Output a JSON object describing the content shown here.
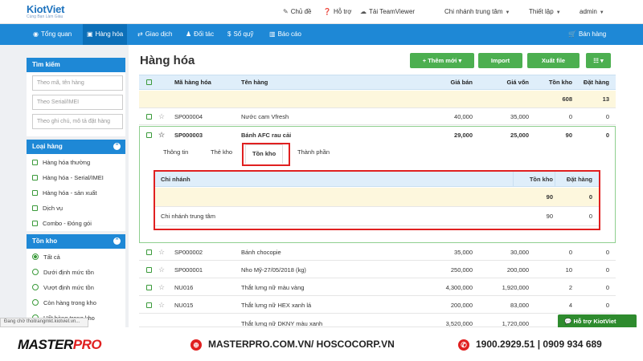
{
  "app": {
    "logo": "KiotViet",
    "tagline": "Cùng Bạn Làm Giàu"
  },
  "topbar": {
    "theme": "Chủ đề",
    "support": "Hỗ trợ",
    "teamviewer": "Tải TeamViewer",
    "branch": "Chi nhánh trung tâm",
    "settings": "Thiết lập",
    "user": "admin"
  },
  "nav": {
    "items": [
      "Tổng quan",
      "Hàng hóa",
      "Giao dịch",
      "Đối tác",
      "Sổ quỹ",
      "Báo cáo"
    ],
    "sales": "Bán hàng"
  },
  "sidebar": {
    "search_title": "Tìm kiếm",
    "search_placeholders": [
      "Theo mã, tên hàng",
      "Theo Serial/IMEI",
      "Theo ghi chú, mô tả đặt hàng"
    ],
    "type_title": "Loại hàng",
    "types": [
      "Hàng hóa thường",
      "Hàng hóa - Serial/IMEI",
      "Hàng hóa - sản xuất",
      "Dịch vụ",
      "Combo - Đóng gói"
    ],
    "stock_title": "Tồn kho",
    "stock_options": [
      "Tất cả",
      "Dưới định mức tồn",
      "Vượt định mức tồn",
      "Còn hàng trong kho",
      "Hết hàng trong kho"
    ]
  },
  "main": {
    "title": "Hàng hóa",
    "buttons": {
      "add": "+ Thêm mới ▾",
      "import": "Import",
      "export": "Xuất file",
      "view": "☷ ▾"
    },
    "columns": [
      "Mã hàng hóa",
      "Tên hàng",
      "Giá bán",
      "Giá vốn",
      "Tồn kho",
      "Đặt hàng"
    ],
    "summary": {
      "ton_kho": "608",
      "dat_hang": "13"
    },
    "rows": [
      {
        "code": "SP000004",
        "name": "Nước cam Vfresh",
        "price": "40,000",
        "cost": "35,000",
        "stock": "0",
        "order": "0"
      },
      {
        "code": "SP000003",
        "name": "Bánh AFC rau cải",
        "price": "29,000",
        "cost": "25,000",
        "stock": "90",
        "order": "0"
      },
      {
        "code": "SP000002",
        "name": "Bánh chocopie",
        "price": "35,000",
        "cost": "30,000",
        "stock": "0",
        "order": "0"
      },
      {
        "code": "SP000001",
        "name": "Nho Mỹ-27/05/2018 (kg)",
        "price": "250,000",
        "cost": "200,000",
        "stock": "10",
        "order": "0"
      },
      {
        "code": "NU016",
        "name": "Thắt lưng nữ màu vàng",
        "price": "4,300,000",
        "cost": "1,920,000",
        "stock": "2",
        "order": "0"
      },
      {
        "code": "NU015",
        "name": "Thắt lưng nữ HEX xanh lá",
        "price": "200,000",
        "cost": "83,000",
        "stock": "4",
        "order": "0"
      },
      {
        "code": "",
        "name": "Thắt lưng nữ DKNY màu xanh",
        "price": "3,520,000",
        "cost": "1,720,000",
        "stock": "",
        "order": ""
      }
    ],
    "detail_tabs": [
      "Thông tin",
      "Thẻ kho",
      "Tồn kho",
      "Thành phần"
    ],
    "detail": {
      "columns": [
        "Chi nhánh",
        "Tồn kho",
        "Đặt hàng"
      ],
      "summary": {
        "stock": "90",
        "order": "0"
      },
      "rows": [
        {
          "branch": "Chi nhánh trung tâm",
          "stock": "90",
          "order": "0"
        }
      ]
    }
  },
  "status_bar": "Đang chờ thoitrangmkt.kiotviet.vn...",
  "support_chat": "Hỗ trợ KiotViet",
  "footer": {
    "brand_a": "MASTER",
    "brand_b": "PRO",
    "website": "MASTERPRO.COM.VN/ HOSCOCORP.VN",
    "phone": "1900.2929.51 | 0909 934 689"
  },
  "colors": {
    "primary": "#1e88d6",
    "green": "#4caf50",
    "highlight_red": "#e02020"
  }
}
